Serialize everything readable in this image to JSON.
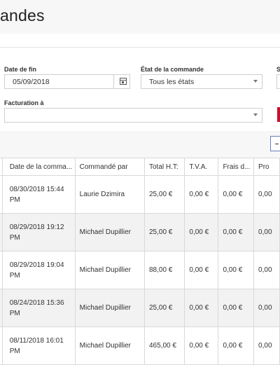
{
  "header": {
    "title": "andes"
  },
  "filters": {
    "end_date_label": "Date de fin",
    "end_date_value": "05/09/2018",
    "order_state_label": "État de la commande",
    "order_state_value": "Tous les états",
    "third_label": "S",
    "billing_label": "Facturation à",
    "billing_value": ""
  },
  "table": {
    "columns": [
      "Date de la comma...",
      "Commandé par",
      "Total H.T:",
      "T.V.A.",
      "Frais d...",
      "Pro"
    ],
    "rows": [
      {
        "left": "PM",
        "date": "08/30/2018 15:44 PM",
        "by": "Laurie Dzimira",
        "total": "25,00 €",
        "tva": "0,00 €",
        "frais": "0,00 €",
        "pro": "0,00"
      },
      {
        "left": "PM",
        "date": "08/29/2018 19:12 PM",
        "by": "Michael Dupillier",
        "total": "25,00 €",
        "tva": "0,00 €",
        "frais": "0,00 €",
        "pro": "0,00"
      },
      {
        "left": "PM",
        "date": "08/29/2018 19:04 PM",
        "by": "Michael Dupillier",
        "total": "88,00 €",
        "tva": "0,00 €",
        "frais": "0,00 €",
        "pro": "0,00"
      },
      {
        "left": "PM",
        "date": "08/24/2018 15:36 PM",
        "by": "Michael Dupillier",
        "total": "25,00 €",
        "tva": "0,00 €",
        "frais": "0,00 €",
        "pro": "0,00"
      },
      {
        "left": "PM",
        "date": "08/11/2018 16:01 PM",
        "by": "Michael Dupillier",
        "total": "465,00 €",
        "tva": "0,00 €",
        "frais": "0,00 €",
        "pro": "0,00"
      }
    ]
  }
}
